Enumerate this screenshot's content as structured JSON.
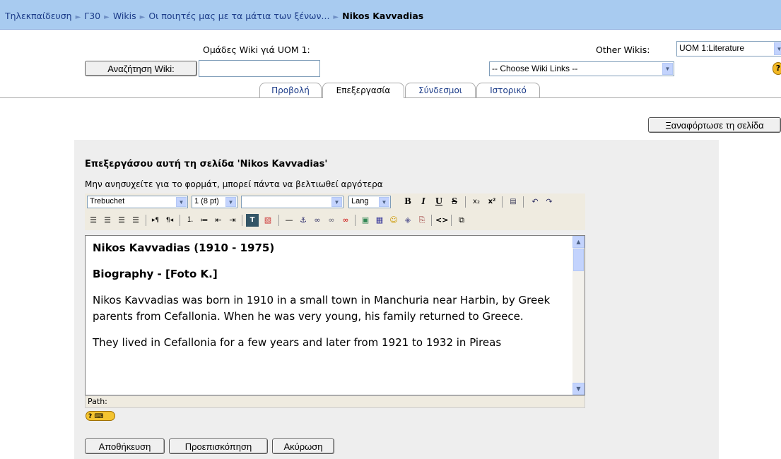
{
  "breadcrumb": {
    "items": [
      "Τηλεκπαίδευση",
      "Γ30",
      "Wikis",
      "Οι ποιητές μας με τα μάτια των ξένων..."
    ],
    "current": "Nikos Kavvadias",
    "separator": "►"
  },
  "header": {
    "wiki_groups_label": "Ομάδες Wiki γιά UOM 1:",
    "other_wikis_label": "Other Wikis:",
    "other_wikis_value": "UOM 1:Literature",
    "search_button": "Αναζήτηση Wiki:",
    "search_value": "",
    "wiki_links_value": "-- Choose Wiki Links --",
    "help_icon": "?"
  },
  "tabs": [
    {
      "label": "Προβολή",
      "active": false
    },
    {
      "label": "Επεξεργασία",
      "active": true
    },
    {
      "label": "Σύνδεσμοι",
      "active": false
    },
    {
      "label": "Ιστορικό",
      "active": false
    }
  ],
  "reload_button": "Ξαναφόρτωσε τη σελίδα",
  "editor": {
    "heading": "Επεξεργάσου αυτή τη σελίδα 'Nikos Kavvadias'",
    "hint": "Μην ανησυχείτε για το φορμάτ, μπορεί πάντα να βελτιωθεί αργότερα",
    "font_value": "Trebuchet",
    "size_value": "1 (8 pt)",
    "style_value": "",
    "lang_value": "Lang",
    "path_label": "Path:",
    "content": {
      "title": "Nikos Kavvadias (1910 - 1975)",
      "subtitle": "Biography - [Foto K.]",
      "para1": "Nikos Kavvadias was born in 1910 in a small town in Manchuria near Harbin, by Greek parents from Cefallonia. When he was very young, his family returned to Greece.",
      "para2": "They lived in Cefallonia for a few years and later from 1921 to 1932 in Pireas"
    }
  },
  "actions": {
    "save": "Αποθήκευση",
    "preview": "Προεπισκόπηση",
    "cancel": "Ακύρωση"
  }
}
